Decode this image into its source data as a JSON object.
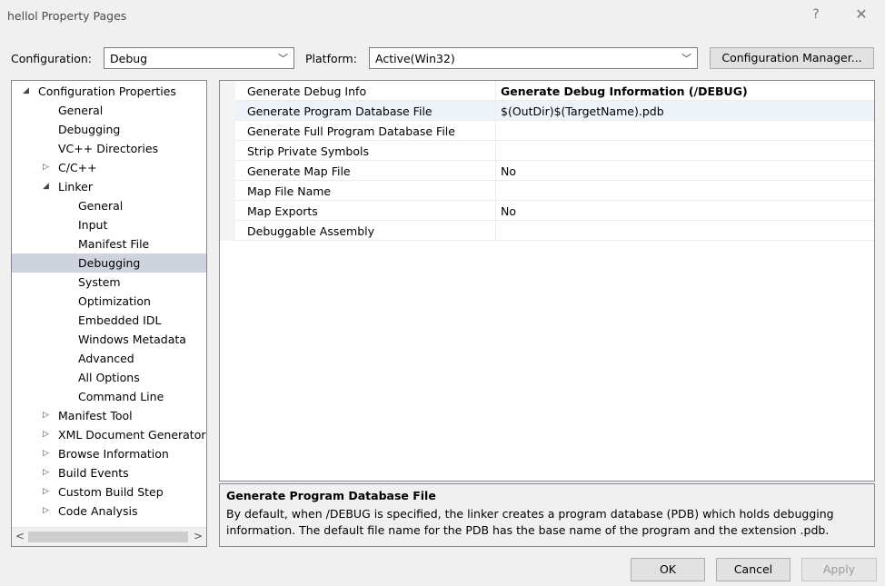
{
  "window": {
    "title": "hellol Property Pages",
    "help_glyph": "?",
    "close_glyph": "✕"
  },
  "config_bar": {
    "configuration_label": "Configuration:",
    "configuration_value": "Debug",
    "platform_label": "Platform:",
    "platform_value": "Active(Win32)",
    "manager_button": "Configuration Manager..."
  },
  "tree": {
    "items": [
      {
        "label": "Configuration Properties",
        "twisty": "◢"
      },
      {
        "label": "General"
      },
      {
        "label": "Debugging"
      },
      {
        "label": "VC++ Directories"
      },
      {
        "label": "C/C++",
        "twisty": "▷"
      },
      {
        "label": "Linker",
        "twisty": "◢"
      },
      {
        "label": "General"
      },
      {
        "label": "Input"
      },
      {
        "label": "Manifest File"
      },
      {
        "label": "Debugging",
        "selected": true
      },
      {
        "label": "System"
      },
      {
        "label": "Optimization"
      },
      {
        "label": "Embedded IDL"
      },
      {
        "label": "Windows Metadata"
      },
      {
        "label": "Advanced"
      },
      {
        "label": "All Options"
      },
      {
        "label": "Command Line"
      },
      {
        "label": "Manifest Tool",
        "twisty": "▷"
      },
      {
        "label": "XML Document Generator",
        "twisty": "▷"
      },
      {
        "label": "Browse Information",
        "twisty": "▷"
      },
      {
        "label": "Build Events",
        "twisty": "▷"
      },
      {
        "label": "Custom Build Step",
        "twisty": "▷"
      },
      {
        "label": "Code Analysis",
        "twisty": "▷"
      }
    ],
    "scroll_left": "<",
    "scroll_right": ">"
  },
  "properties": [
    {
      "name": "Generate Debug Info",
      "value": "Generate Debug Information (/DEBUG)",
      "bold": true
    },
    {
      "name": "Generate Program Database File",
      "value": "$(OutDir)$(TargetName).pdb",
      "selected": true
    },
    {
      "name": "Generate Full Program Database File",
      "value": ""
    },
    {
      "name": "Strip Private Symbols",
      "value": ""
    },
    {
      "name": "Generate Map File",
      "value": "No"
    },
    {
      "name": "Map File Name",
      "value": ""
    },
    {
      "name": "Map Exports",
      "value": "No"
    },
    {
      "name": "Debuggable Assembly",
      "value": ""
    }
  ],
  "description": {
    "title": "Generate Program Database File",
    "text": "By default, when /DEBUG is specified, the linker creates a program database (PDB) which holds debugging information. The default file name for the PDB has the base name of the program and the extension .pdb."
  },
  "buttons": {
    "ok": "OK",
    "cancel": "Cancel",
    "apply": "Apply"
  }
}
